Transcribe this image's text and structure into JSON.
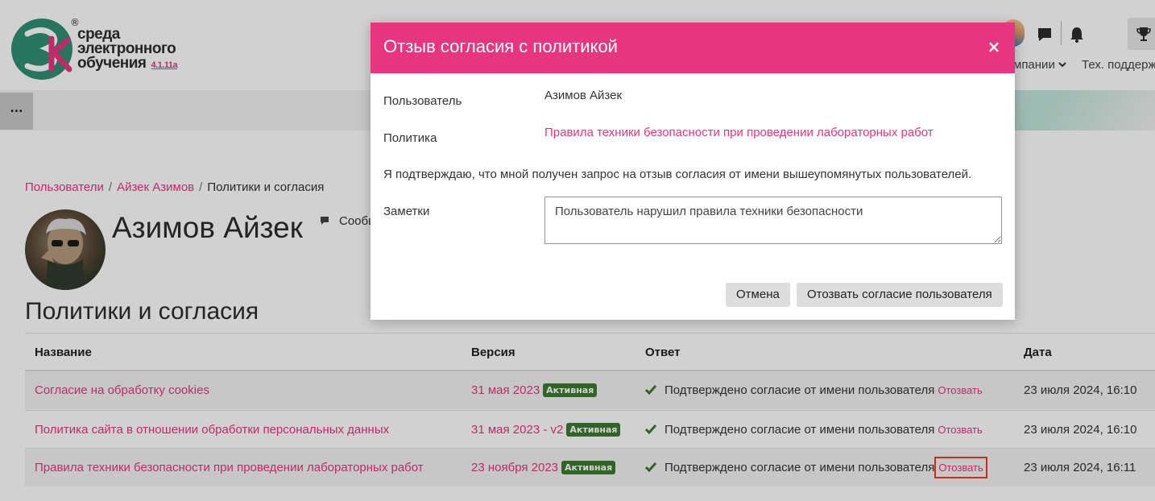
{
  "header": {
    "logo_text_lines": [
      "среда",
      "электронного",
      "обучения"
    ],
    "logo_version": "4.1.11a",
    "logo_reg": "®",
    "nav_company": "мпании",
    "nav_support": "Тех. поддерж"
  },
  "nav": {
    "more_label": "..."
  },
  "breadcrumb": {
    "items": [
      "Пользователи",
      "Айзек Азимов",
      "Политики и согласия"
    ],
    "separator": "/"
  },
  "profile": {
    "name": "Азимов Айзек",
    "message_label": "Сообщ"
  },
  "section": {
    "title": "Политики и согласия"
  },
  "table": {
    "headers": [
      "Название",
      "Версия",
      "Ответ",
      "Дата"
    ],
    "rows": [
      {
        "name": "Согласие на обработку cookies",
        "version": "31 мая 2023",
        "badge": "Активная",
        "response": "Подтверждено согласие от имени пользователя",
        "revoke": "Отозвать",
        "date": "23 июля 2024, 16:10"
      },
      {
        "name": "Политика сайта в отношении обработки персональных данных",
        "version": "31 мая 2023 - v2",
        "badge": "Активная",
        "response": "Подтверждено согласие от имени пользователя",
        "revoke": "Отозвать",
        "date": "23 июля 2024, 16:10"
      },
      {
        "name": "Правила техники безопасности при проведении лабораторных работ",
        "version": "23 ноября 2023",
        "badge": "Активная",
        "response": "Подтверждено согласие от имени пользователя",
        "revoke": "Отозвать",
        "date": "23 июля 2024, 16:11"
      }
    ]
  },
  "modal": {
    "title": "Отзыв согласия с политикой",
    "close": "×",
    "user_label": "Пользователь",
    "user_value": "Азимов Айзек",
    "policy_label": "Политика",
    "policy_value": "Правила техники безопасности при проведении лабораторных работ",
    "confirm_text": "Я подтверждаю, что мной получен запрос на отзыв согласия от имени вышеупомянутых пользователей.",
    "notes_label": "Заметки",
    "notes_value": "Пользователь нарушил правила техники безопасности",
    "cancel_label": "Отмена",
    "submit_label": "Отозвать согласие пользователя"
  },
  "colors": {
    "accent": "#e7357f",
    "badge": "#3d7b30",
    "check": "#3d7b30",
    "highlight": "#e43c33",
    "logo_green": "#2f8f74"
  },
  "icons": {
    "close": "close-icon",
    "check": "check-icon",
    "chat": "chat-icon",
    "bell": "bell-icon",
    "trophy": "trophy-icon",
    "message": "message-icon",
    "chevron": "chevron-down-icon"
  }
}
